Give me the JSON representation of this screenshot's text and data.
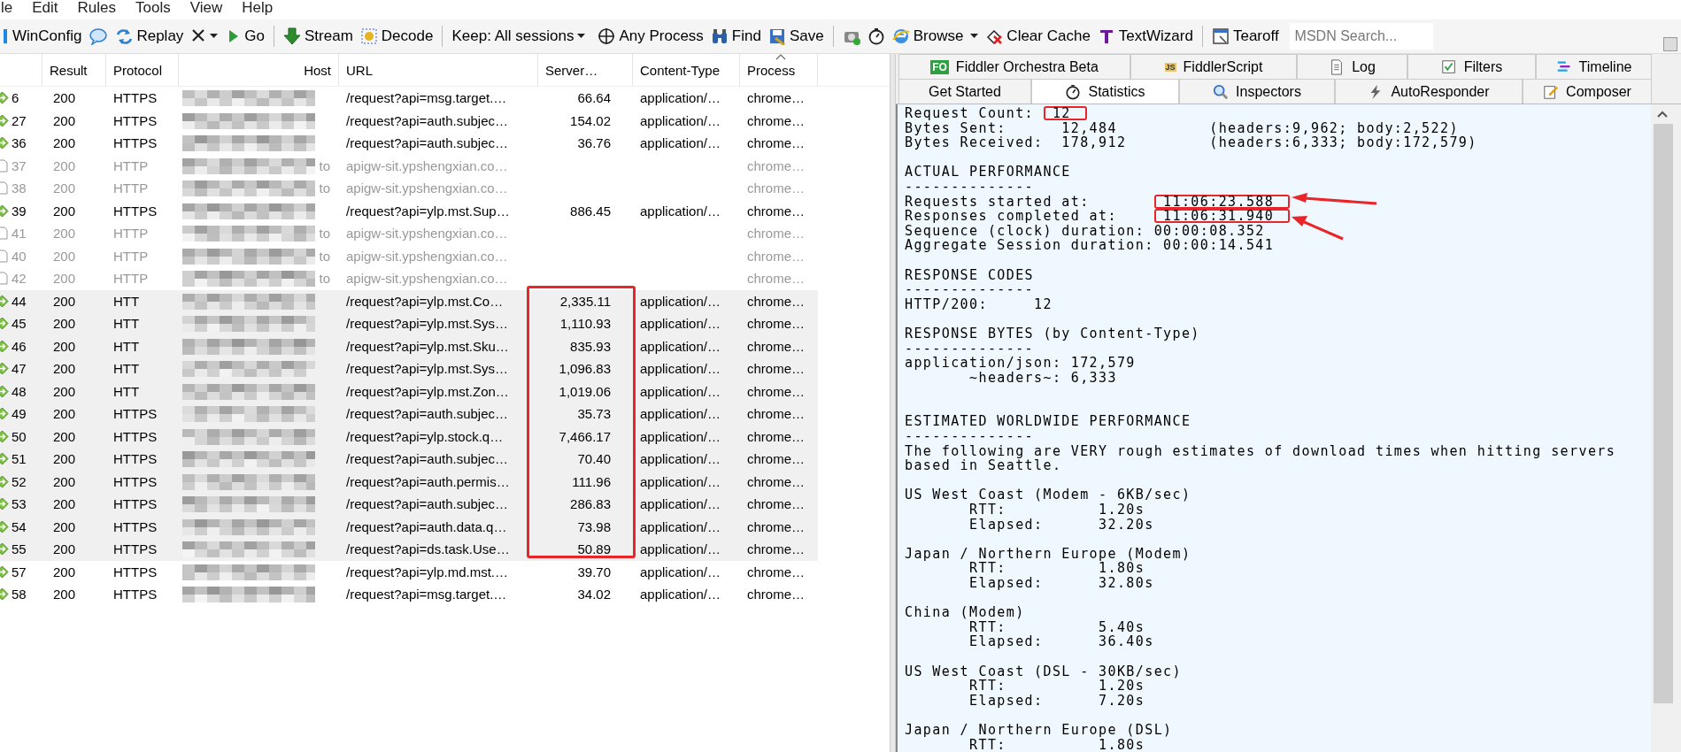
{
  "menu": [
    "le",
    "Edit",
    "Rules",
    "Tools",
    "View",
    "Help"
  ],
  "toolbar": [
    {
      "kind": "button",
      "label": "WinConfig"
    },
    {
      "kind": "icon"
    },
    {
      "kind": "button",
      "label": "Replay"
    },
    {
      "kind": "menu_icon"
    },
    {
      "kind": "button",
      "label": "Go"
    },
    {
      "kind": "separator"
    },
    {
      "kind": "button",
      "label": "Stream"
    },
    {
      "kind": "button",
      "label": "Decode"
    },
    {
      "kind": "separator"
    },
    {
      "kind": "dropdown",
      "label": "Keep: All sessions"
    },
    {
      "kind": "button",
      "label": "Any Process"
    },
    {
      "kind": "button",
      "label": "Find"
    },
    {
      "kind": "button",
      "label": "Save"
    },
    {
      "kind": "separator"
    },
    {
      "kind": "icon"
    },
    {
      "kind": "icon"
    },
    {
      "kind": "split",
      "label": "Browse"
    },
    {
      "kind": "button",
      "label": "Clear Cache"
    },
    {
      "kind": "button",
      "label": "TextWizard"
    },
    {
      "kind": "separator"
    },
    {
      "kind": "button",
      "label": "Tearoff"
    },
    {
      "kind": "search",
      "placeholder": "MSDN Search..."
    }
  ],
  "columns": [
    {
      "label": "Result",
      "sorted": false
    },
    {
      "label": "Protocol",
      "sorted": false
    },
    {
      "label": "Host",
      "sorted": false
    },
    {
      "label": "URL",
      "sorted": false
    },
    {
      "label": "Server…",
      "sorted": false
    },
    {
      "label": "Content-Type",
      "sorted": false
    },
    {
      "label": "Process",
      "sorted": true
    }
  ],
  "rows": [
    {
      "id": "6",
      "kind": "https",
      "result": "200",
      "protocol": "HTTPS",
      "url": "/request?api=msg.target.…",
      "server": "66.64",
      "content_type": "application/…",
      "process": "chrome…",
      "selected": false,
      "marked": false
    },
    {
      "id": "27",
      "kind": "https",
      "result": "200",
      "protocol": "HTTPS",
      "url": "/request?api=auth.subjec…",
      "server": "154.02",
      "content_type": "application/…",
      "process": "chrome…",
      "selected": false,
      "marked": false
    },
    {
      "id": "36",
      "kind": "https",
      "result": "200",
      "protocol": "HTTPS",
      "url": "/request?api=auth.subjec…",
      "server": "36.76",
      "content_type": "application/…",
      "process": "chrome…",
      "selected": false,
      "marked": false
    },
    {
      "id": "37",
      "kind": "tunnel",
      "result": "200",
      "protocol": "HTTP",
      "host": "to",
      "url": "apigw-sit.ypshengxian.co…",
      "process": "chrome…",
      "selected": false,
      "marked": false
    },
    {
      "id": "38",
      "kind": "tunnel",
      "result": "200",
      "protocol": "HTTP",
      "host": "to",
      "url": "apigw-sit.ypshengxian.co…",
      "process": "chrome…",
      "selected": false,
      "marked": false
    },
    {
      "id": "39",
      "kind": "https",
      "result": "200",
      "protocol": "HTTPS",
      "url": "/request?api=ylp.mst.Sup…",
      "server": "886.45",
      "content_type": "application/…",
      "process": "chrome…",
      "selected": false,
      "marked": false
    },
    {
      "id": "41",
      "kind": "tunnel",
      "result": "200",
      "protocol": "HTTP",
      "host": "to",
      "url": "apigw-sit.ypshengxian.co…",
      "process": "chrome…",
      "selected": false,
      "marked": false
    },
    {
      "id": "40",
      "kind": "tunnel",
      "result": "200",
      "protocol": "HTTP",
      "host": "to",
      "url": "apigw-sit.ypshengxian.co…",
      "process": "chrome…",
      "selected": false,
      "marked": false
    },
    {
      "id": "42",
      "kind": "tunnel",
      "result": "200",
      "protocol": "HTTP",
      "host": "to",
      "url": "apigw-sit.ypshengxian.co…",
      "process": "chrome…",
      "selected": false,
      "marked": false
    },
    {
      "id": "44",
      "kind": "https",
      "result": "200",
      "protocol": "HTT",
      "url": "/request?api=ylp.mst.Co…",
      "server": "2,335.11",
      "content_type": "application/…",
      "process": "chrome…",
      "selected": true,
      "marked": true
    },
    {
      "id": "45",
      "kind": "https",
      "result": "200",
      "protocol": "HTT",
      "url": "/request?api=ylp.mst.Sys…",
      "server": "1,110.93",
      "content_type": "application/…",
      "process": "chrome…",
      "selected": true,
      "marked": true
    },
    {
      "id": "46",
      "kind": "https",
      "result": "200",
      "protocol": "HTT",
      "url": "/request?api=ylp.mst.Sku…",
      "server": "835.93",
      "content_type": "application/…",
      "process": "chrome…",
      "selected": true,
      "marked": true
    },
    {
      "id": "47",
      "kind": "https",
      "result": "200",
      "protocol": "HTT",
      "url": "/request?api=ylp.mst.Sys…",
      "server": "1,096.83",
      "content_type": "application/…",
      "process": "chrome…",
      "selected": true,
      "marked": true
    },
    {
      "id": "48",
      "kind": "https",
      "result": "200",
      "protocol": "HTT",
      "url": "/request?api=ylp.mst.Zon…",
      "server": "1,019.06",
      "content_type": "application/…",
      "process": "chrome…",
      "selected": true,
      "marked": true
    },
    {
      "id": "49",
      "kind": "https",
      "result": "200",
      "protocol": "HTTPS",
      "url": "/request?api=auth.subjec…",
      "server": "35.73",
      "content_type": "application/…",
      "process": "chrome…",
      "selected": true,
      "marked": true
    },
    {
      "id": "50",
      "kind": "https",
      "result": "200",
      "protocol": "HTTPS",
      "url": "/request?api=ylp.stock.q…",
      "server": "7,466.17",
      "content_type": "application/…",
      "process": "chrome…",
      "selected": true,
      "marked": true
    },
    {
      "id": "51",
      "kind": "https",
      "result": "200",
      "protocol": "HTTPS",
      "url": "/request?api=auth.subjec…",
      "server": "70.40",
      "content_type": "application/…",
      "process": "chrome…",
      "selected": true,
      "marked": true
    },
    {
      "id": "52",
      "kind": "https",
      "result": "200",
      "protocol": "HTTPS",
      "url": "/request?api=auth.permis…",
      "server": "111.96",
      "content_type": "application/…",
      "process": "chrome…",
      "selected": true,
      "marked": true
    },
    {
      "id": "53",
      "kind": "https",
      "result": "200",
      "protocol": "HTTPS",
      "url": "/request?api=auth.subjec…",
      "server": "286.83",
      "content_type": "application/…",
      "process": "chrome…",
      "selected": true,
      "marked": true
    },
    {
      "id": "54",
      "kind": "https",
      "result": "200",
      "protocol": "HTTPS",
      "url": "/request?api=auth.data.q…",
      "server": "73.98",
      "content_type": "application/…",
      "process": "chrome…",
      "selected": true,
      "marked": true
    },
    {
      "id": "55",
      "kind": "https",
      "result": "200",
      "protocol": "HTTPS",
      "url": "/request?api=ds.task.Use…",
      "server": "50.89",
      "content_type": "application/…",
      "process": "chrome…",
      "selected": true,
      "marked": true
    },
    {
      "id": "57",
      "kind": "https",
      "result": "200",
      "protocol": "HTTPS",
      "url": "/request?api=ylp.md.mst.…",
      "server": "39.70",
      "content_type": "application/…",
      "process": "chrome…",
      "selected": false,
      "marked": false
    },
    {
      "id": "58",
      "kind": "https",
      "result": "200",
      "protocol": "HTTPS",
      "url": "/request?api=msg.target.…",
      "server": "34.02",
      "content_type": "application/…",
      "process": "chrome…",
      "selected": false,
      "marked": false
    }
  ],
  "tabs_back": [
    {
      "label": "Fiddler Orchestra Beta",
      "badge": "FO",
      "selected": false
    },
    {
      "label": "FiddlerScript",
      "badge": "JS",
      "selected": false
    },
    {
      "label": "Log",
      "selected": false
    },
    {
      "label": "Filters",
      "selected": false
    },
    {
      "label": "Timeline",
      "selected": false
    }
  ],
  "tabs_front": [
    {
      "label": "Get Started",
      "selected": false
    },
    {
      "label": "Statistics",
      "selected": true
    },
    {
      "label": "Inspectors",
      "selected": false
    },
    {
      "label": "AutoResponder",
      "selected": false
    },
    {
      "label": "Composer",
      "selected": false
    }
  ],
  "statistics": [
    {
      "kind": "text",
      "text": "Request Count:  ",
      "mark": "12"
    },
    {
      "kind": "text",
      "text": "Bytes Sent:      12,484          (headers:9,962; body:2,522)"
    },
    {
      "kind": "text",
      "text": "Bytes Received:  178,912         (headers:6,333; body:172,579)"
    },
    {
      "kind": "blank"
    },
    {
      "kind": "text",
      "text": "ACTUAL PERFORMANCE"
    },
    {
      "kind": "text",
      "text": "--------------"
    },
    {
      "kind": "text",
      "text": "Requests started at:        ",
      "mark": "11:06:23.588",
      "arrow": true
    },
    {
      "kind": "text",
      "text": "Responses completed at:     ",
      "mark": "11:06:31.940",
      "arrow": true
    },
    {
      "kind": "text",
      "text": "Sequence (clock) duration: 00:00:08.352"
    },
    {
      "kind": "text",
      "text": "Aggregate Session duration: 00:00:14.541"
    },
    {
      "kind": "blank"
    },
    {
      "kind": "text",
      "text": "RESPONSE CODES"
    },
    {
      "kind": "text",
      "text": "--------------"
    },
    {
      "kind": "text",
      "text": "HTTP/200:     12"
    },
    {
      "kind": "blank"
    },
    {
      "kind": "text",
      "text": "RESPONSE BYTES (by Content-Type)"
    },
    {
      "kind": "text",
      "text": "--------------"
    },
    {
      "kind": "text",
      "text": "application/json: 172,579"
    },
    {
      "kind": "text",
      "text": "       ~headers~: 6,333"
    },
    {
      "kind": "blank"
    },
    {
      "kind": "blank"
    },
    {
      "kind": "text",
      "text": "ESTIMATED WORLDWIDE PERFORMANCE"
    },
    {
      "kind": "text",
      "text": "--------------"
    },
    {
      "kind": "text",
      "text": "The following are VERY rough estimates of download times when hitting servers"
    },
    {
      "kind": "text",
      "text": "based in Seattle."
    },
    {
      "kind": "blank"
    },
    {
      "kind": "text",
      "text": "US West Coast (Modem - 6KB/sec)"
    },
    {
      "kind": "text",
      "text": "       RTT:          1.20s"
    },
    {
      "kind": "text",
      "text": "       Elapsed:      32.20s"
    },
    {
      "kind": "blank"
    },
    {
      "kind": "text",
      "text": "Japan / Northern Europe (Modem)"
    },
    {
      "kind": "text",
      "text": "       RTT:          1.80s"
    },
    {
      "kind": "text",
      "text": "       Elapsed:      32.80s"
    },
    {
      "kind": "blank"
    },
    {
      "kind": "text",
      "text": "China (Modem)"
    },
    {
      "kind": "text",
      "text": "       RTT:          5.40s"
    },
    {
      "kind": "text",
      "text": "       Elapsed:      36.40s"
    },
    {
      "kind": "blank"
    },
    {
      "kind": "text",
      "text": "US West Coast (DSL - 30KB/sec)"
    },
    {
      "kind": "text",
      "text": "       RTT:          1.20s"
    },
    {
      "kind": "text",
      "text": "       Elapsed:      7.20s"
    },
    {
      "kind": "blank"
    },
    {
      "kind": "text",
      "text": "Japan / Northern Europe (DSL)"
    },
    {
      "kind": "text",
      "text": "       RTT:          1.80s"
    }
  ]
}
